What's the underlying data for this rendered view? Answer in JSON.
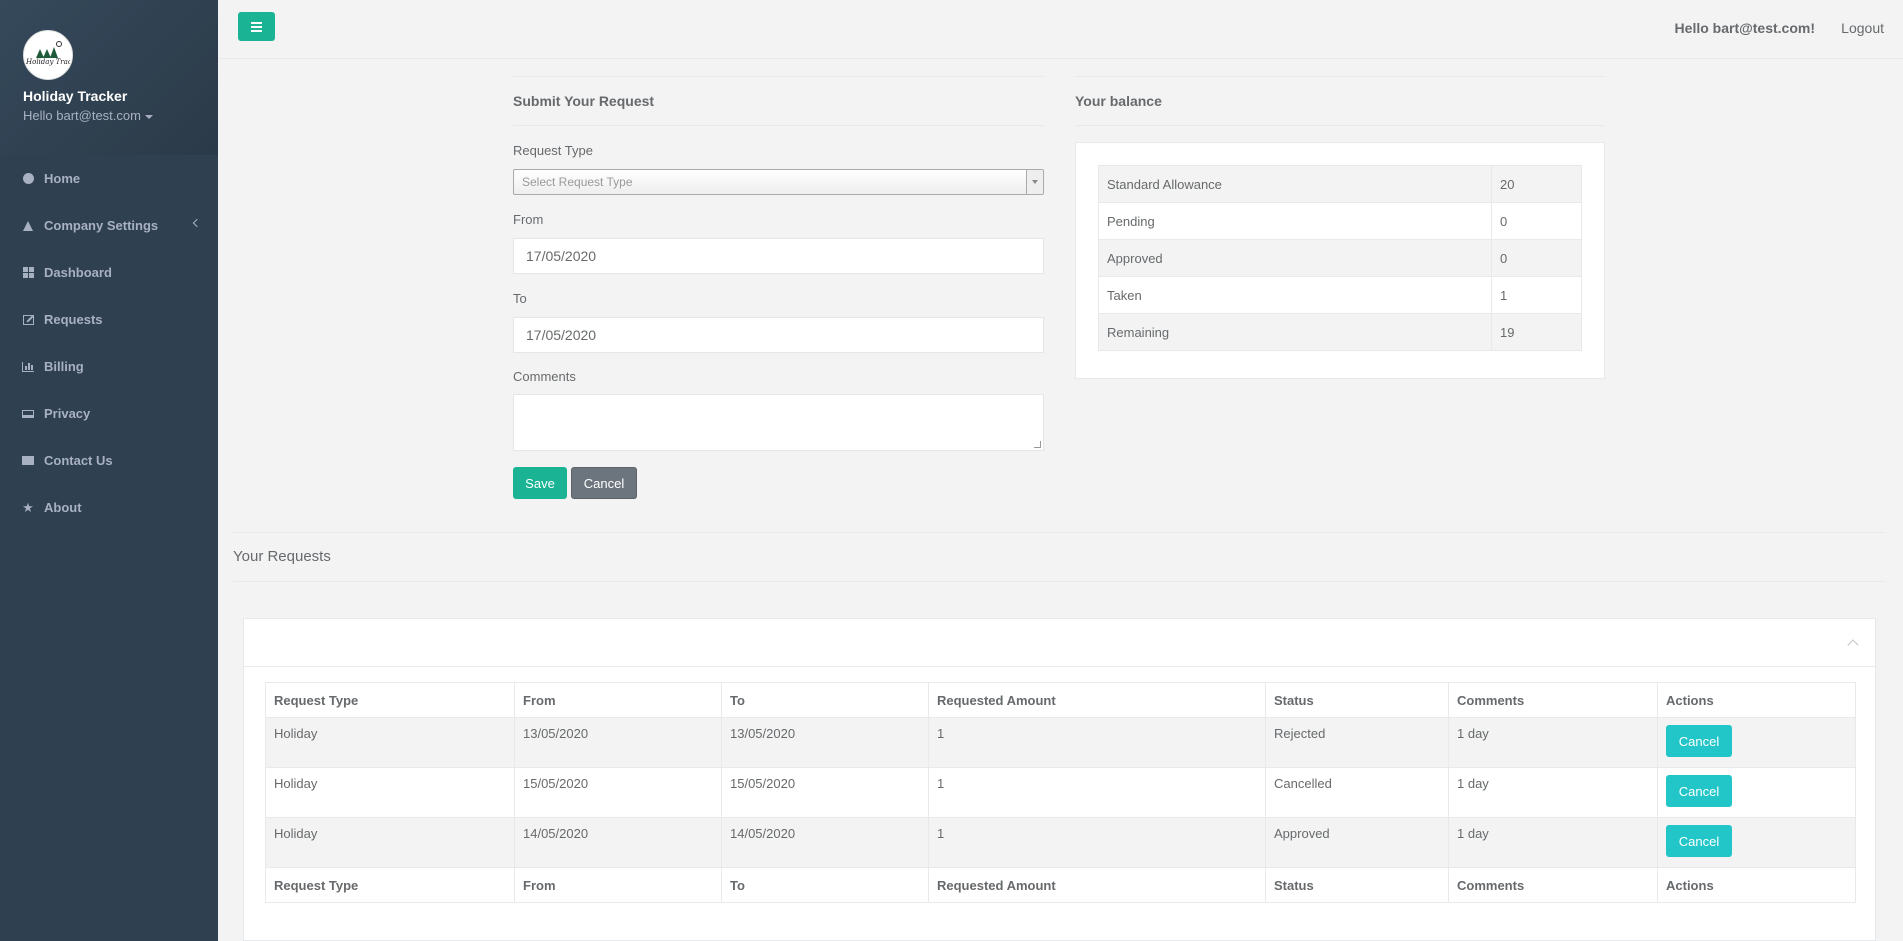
{
  "sidebar": {
    "app_name": "Holiday Tracker",
    "user": "Hello bart@test.com",
    "logo_text": "Holiday Tracker",
    "items": [
      {
        "label": "Home",
        "icon": "globe-icon"
      },
      {
        "label": "Company Settings",
        "icon": "flask-icon"
      },
      {
        "label": "Dashboard",
        "icon": "dashboard-icon"
      },
      {
        "label": "Requests",
        "icon": "edit-icon"
      },
      {
        "label": "Billing",
        "icon": "bar-chart-icon"
      },
      {
        "label": "Privacy",
        "icon": "laptop-icon"
      },
      {
        "label": "Contact Us",
        "icon": "envelope-icon"
      },
      {
        "label": "About",
        "icon": "star-icon"
      }
    ]
  },
  "header": {
    "greeting": "Hello bart@test.com!",
    "logout": "Logout"
  },
  "form": {
    "title": "Submit Your Request",
    "request_type_label": "Request Type",
    "request_type_placeholder": "Select Request Type",
    "from_label": "From",
    "from_value": "17/05/2020",
    "to_label": "To",
    "to_value": "17/05/2020",
    "comments_label": "Comments",
    "save": "Save",
    "cancel": "Cancel"
  },
  "balance": {
    "title": "Your balance",
    "rows": [
      {
        "label": "Standard Allowance",
        "value": "20"
      },
      {
        "label": "Pending",
        "value": "0"
      },
      {
        "label": "Approved",
        "value": "0"
      },
      {
        "label": "Taken",
        "value": "1"
      },
      {
        "label": "Remaining",
        "value": "19"
      }
    ]
  },
  "requests": {
    "title": "Your Requests",
    "columns": [
      "Request Type",
      "From",
      "To",
      "Requested Amount",
      "Status",
      "Comments",
      "Actions"
    ],
    "rows": [
      {
        "type": "Holiday",
        "from": "13/05/2020",
        "to": "13/05/2020",
        "amount": "1",
        "status": "Rejected",
        "comments": "1 day",
        "action": "Cancel"
      },
      {
        "type": "Holiday",
        "from": "15/05/2020",
        "to": "15/05/2020",
        "amount": "1",
        "status": "Cancelled",
        "comments": "1 day",
        "action": "Cancel"
      },
      {
        "type": "Holiday",
        "from": "14/05/2020",
        "to": "14/05/2020",
        "amount": "1",
        "status": "Approved",
        "comments": "1 day",
        "action": "Cancel"
      }
    ]
  },
  "colors": {
    "primary": "#1ab394",
    "info": "#23c6c8",
    "sidebar": "#2f4050"
  }
}
